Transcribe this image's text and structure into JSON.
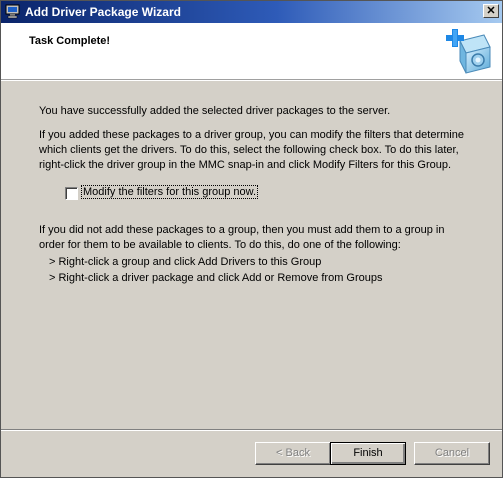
{
  "window": {
    "title": "Add Driver Package Wizard",
    "close_label": "✕"
  },
  "header": {
    "title": "Task Complete!"
  },
  "content": {
    "success_text": "You have successfully added the selected driver packages to the server.",
    "group_text": "If you added these packages to a driver group, you can modify the filters that determine which clients get the drivers. To do this, select the following check box. To do this later, right-click the driver group in the MMC snap-in and click Modify Filters for this Group.",
    "checkbox": {
      "label": "Modify the filters for this group now.",
      "checked": false
    },
    "no_group_text": "If you did not add these packages to a group, then you must add them to a group in order for them to be available to clients. To do this, do one of the following:",
    "options": [
      "> Right-click a group and click Add Drivers to this Group",
      "> Right-click a driver package and click Add or Remove from Groups"
    ]
  },
  "buttons": {
    "back": "< Back",
    "finish": "Finish",
    "cancel": "Cancel"
  },
  "colors": {
    "titlebar_start": "#0a246a",
    "titlebar_end": "#a6caf0",
    "dialog_bg": "#d4d0c8"
  }
}
